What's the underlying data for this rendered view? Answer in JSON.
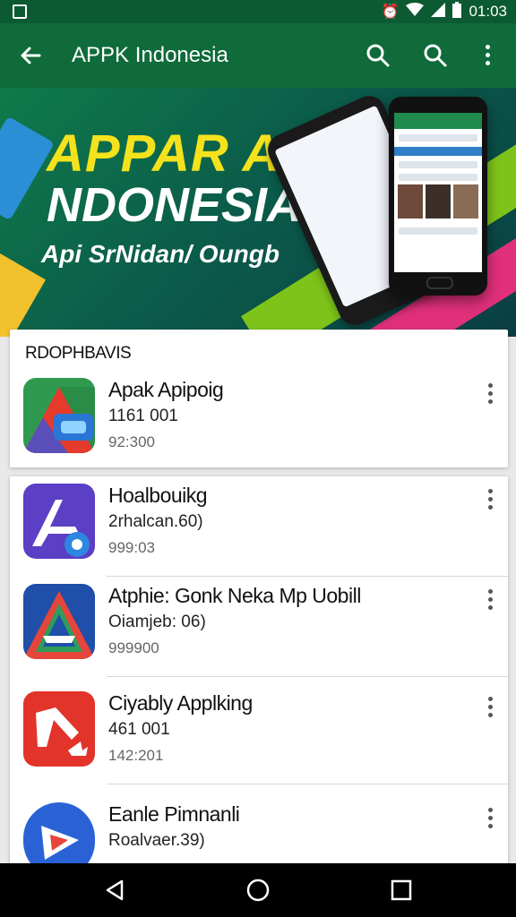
{
  "status_bar": {
    "time": "01:03"
  },
  "app_bar": {
    "title": "APPK Indonesia"
  },
  "banner": {
    "line1": "APPAR APR",
    "line2": "NDONESIA",
    "line3": "Api SrNidan/ Oungb"
  },
  "featured": {
    "section_title": "RDOPHBAVIS",
    "item": {
      "name": "Apak Apipoig",
      "sub": "1161 001",
      "meta": "92:300"
    }
  },
  "list": [
    {
      "name": "Hoalbouikg",
      "sub": "2rhalcan.60)",
      "meta": "999:03"
    },
    {
      "name": "Atphie: Gonk Neka Mp Uobill",
      "sub": "Oiamjeb: 06)",
      "meta": "999900"
    },
    {
      "name": "Ciyably Applking",
      "sub": "461 001",
      "meta": "142:201"
    },
    {
      "name": "Eanle Pimnanli",
      "sub": "Roalvaer.39)",
      "meta": ""
    }
  ],
  "colors": {
    "status_bar": "#0b5a32",
    "app_bar": "#0f6b3a",
    "banner_yellow": "#f4e21d"
  }
}
